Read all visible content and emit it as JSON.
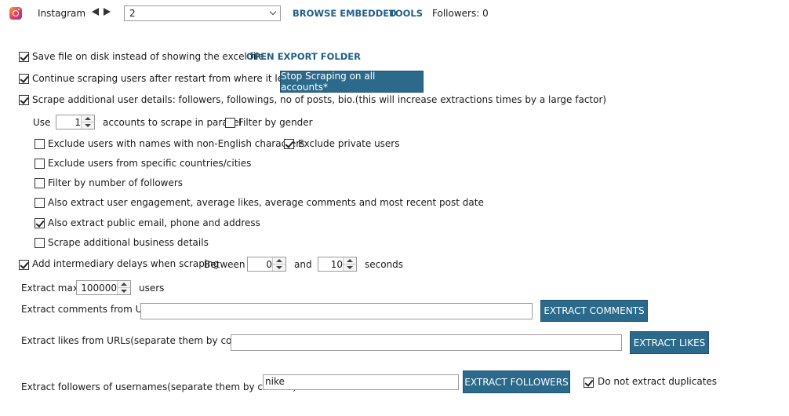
{
  "header": {
    "app_name": "Instagram",
    "account_selected": "2",
    "browse_embedded": "BROWSE EMBEDDED",
    "tools": "TOOLS",
    "followers_status": "Followers: 0"
  },
  "options": {
    "save_file": {
      "label": "Save file on disk instead of showing the excel file",
      "checked": true
    },
    "open_export_folder": "OPEN EXPORT FOLDER",
    "continue_scraping": {
      "label": "Continue scraping users after restart from where it left of",
      "checked": true
    },
    "stop_scraping_button": "Stop Scraping on all accounts*",
    "scrape_additional": {
      "label": "Scrape additional user details: followers, followings, no of posts, bio.(this will increase extractions times by a large factor)",
      "checked": true
    },
    "use_label": "Use",
    "parallel_accounts_value": "1",
    "parallel_label": "accounts to scrape in parallel",
    "filter_gender": {
      "label": "Filter by gender",
      "checked": false
    },
    "exclude_non_english": {
      "label": "Exclude users with names with non-English characters",
      "checked": false
    },
    "exclude_private": {
      "label": "Exclude private users",
      "checked": true
    },
    "exclude_countries": {
      "label": "Exclude users from specific countries/cities",
      "checked": false
    },
    "filter_followers": {
      "label": "Filter by number of followers",
      "checked": false
    },
    "extract_engagement": {
      "label": "Also extract user engagement, average likes, average comments and most recent post date",
      "checked": false
    },
    "extract_email": {
      "label": "Also extract public email, phone and address",
      "checked": true
    },
    "scrape_business": {
      "label": "Scrape additional business details",
      "checked": false
    },
    "delays": {
      "label": "Add intermediary delays when scraping",
      "checked": true
    },
    "between_label": "Between",
    "delay_min": "0",
    "and_label": "and",
    "delay_max": "10",
    "seconds_label": "seconds",
    "extract_max_label": "Extract max",
    "extract_max_value": "100000",
    "users_label": "users"
  },
  "extract": {
    "comments_label": "Extract comments from URL",
    "comments_value": "",
    "comments_button": "EXTRACT COMMENTS",
    "likes_label": "Extract likes from URLs(separate them by comma)",
    "likes_value": "",
    "likes_button": "EXTRACT LIKES",
    "followers_label": "Extract followers of usernames(separate them by comma)",
    "followers_value": "nike",
    "followers_button": "EXTRACT FOLLOWERS",
    "no_duplicates": {
      "label": "Do not extract duplicates",
      "checked": true
    }
  }
}
